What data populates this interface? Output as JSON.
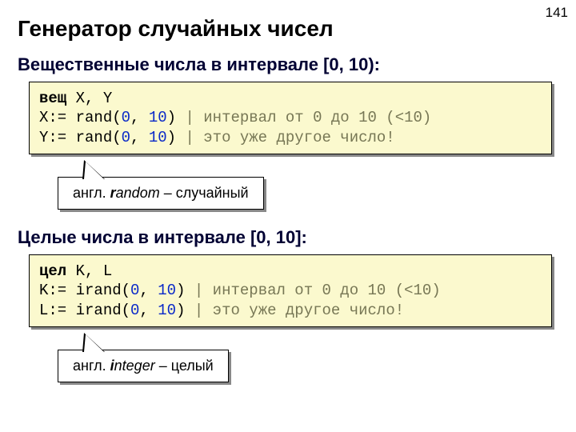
{
  "page_number": "141",
  "title": "Генератор случайных чисел",
  "section1": {
    "heading": "Вещественные числа в интервале [0, 10):",
    "code": {
      "l1_kw": "вещ",
      "l1_vars": " X, Y",
      "l2a": "X:= rand(",
      "l2n1": "0",
      "l2b": ", ",
      "l2n2": "10",
      "l2c": ") ",
      "l2comment": "| интервал от 0 до 10 (<10)",
      "l3a": "Y:= rand(",
      "l3n1": "0",
      "l3b": ", ",
      "l3n2": "10",
      "l3c": ") ",
      "l3comment": "| это уже другое число!"
    },
    "callout_prefix": "англ. ",
    "callout_word_head": "r",
    "callout_word_tail": "andom",
    "callout_trans": " – случайный"
  },
  "section2": {
    "heading": "Целые числа в интервале [0, 10]:",
    "code": {
      "l1_kw": "цел",
      "l1_vars": " K, L",
      "l2a": "K:= irand(",
      "l2n1": "0",
      "l2b": ", ",
      "l2n2": "10",
      "l2c": ") ",
      "l2comment": "| интервал от 0 до 10 (<10)",
      "l3a": "L:= irand(",
      "l3n1": "0",
      "l3b": ", ",
      "l3n2": "10",
      "l3c": ") ",
      "l3comment": "| это уже другое число!"
    },
    "callout_prefix": "англ. ",
    "callout_word_head": "i",
    "callout_word_tail": "nteger",
    "callout_trans": " – целый"
  }
}
